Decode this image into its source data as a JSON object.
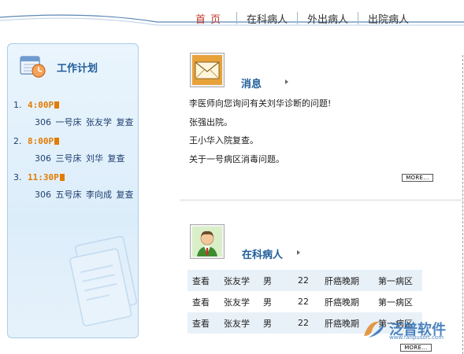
{
  "nav": {
    "items": [
      {
        "label": "首页",
        "active": true
      },
      {
        "label": "在科病人",
        "active": false
      },
      {
        "label": "外出病人",
        "active": false
      },
      {
        "label": "出院病人",
        "active": false
      }
    ]
  },
  "plan": {
    "title": "工作计划",
    "icon": "calendar-clock-icon",
    "entries": [
      {
        "num": "1.",
        "time": "4:00P",
        "room": "306",
        "bed": "一号床",
        "patient": "张友学",
        "action": "复查"
      },
      {
        "num": "2.",
        "time": "8:00P",
        "room": "306",
        "bed": "三号床",
        "patient": "刘华",
        "action": "复查"
      },
      {
        "num": "3.",
        "time": "11:30P",
        "room": "306",
        "bed": "五号床",
        "patient": "李向成",
        "action": "复查"
      }
    ]
  },
  "messages": {
    "title": "消息",
    "icon": "envelope-icon",
    "items": [
      "李医师向您询问有关刘华诊断的问题!",
      "张强出院。",
      "王小华入院复查。",
      "关于一号病区消毒问题。"
    ],
    "more_label": "MORE..."
  },
  "inpatients": {
    "title": "在科病人",
    "icon": "doctor-avatar-icon",
    "rows": [
      {
        "view": "查看",
        "name": "张友学",
        "sex": "男",
        "age": "22",
        "diagnosis": "肝癌晚期",
        "ward": "第一病区"
      },
      {
        "view": "查看",
        "name": "张友学",
        "sex": "男",
        "age": "22",
        "diagnosis": "肝癌晚期",
        "ward": "第一病区"
      },
      {
        "view": "查看",
        "name": "张友学",
        "sex": "男",
        "age": "22",
        "diagnosis": "肝癌晚期",
        "ward": "第一病区"
      }
    ],
    "more_label": "MORE..."
  },
  "watermark": {
    "text": "泛普软件",
    "sub": "www.fanpusoft.com"
  },
  "colors": {
    "accent_blue": "#1f5d9b",
    "time_orange": "#e37b00",
    "active_nav": "#c0392b",
    "panel_bg": "#dcedfa"
  }
}
